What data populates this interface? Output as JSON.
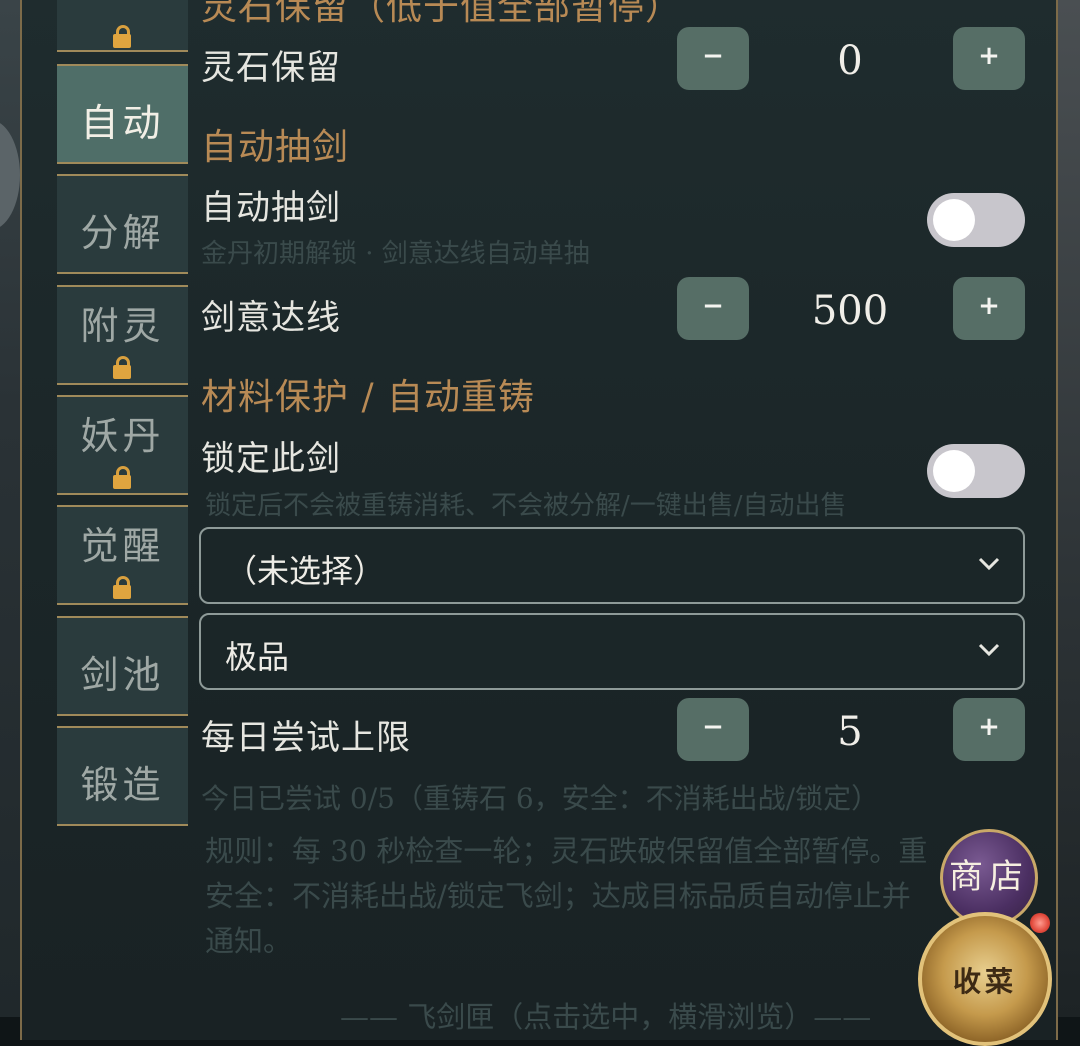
{
  "sidebar": {
    "items": [
      {
        "label": "",
        "locked": true
      },
      {
        "label": "自动",
        "locked": false,
        "active": true
      },
      {
        "label": "分解",
        "locked": false
      },
      {
        "label": "附灵",
        "locked": true
      },
      {
        "label": "妖丹",
        "locked": true
      },
      {
        "label": "觉醒",
        "locked": true
      },
      {
        "label": "剑池",
        "locked": false
      },
      {
        "label": "锻造",
        "locked": false
      }
    ]
  },
  "main": {
    "cropped_section_title": "灵石保留（低于值全部暂停）",
    "spirit_stone": {
      "label": "灵石保留",
      "value": "0",
      "minus": "−",
      "plus": "+"
    },
    "auto_draw_section": "自动抽剑",
    "auto_draw": {
      "label": "自动抽剑",
      "enabled": false,
      "hint": "金丹初期解锁 · 剑意达线自动单抽"
    },
    "sword_intent": {
      "label": "剑意达线",
      "value": "500",
      "minus": "−",
      "plus": "+"
    },
    "protect_section": "材料保护 / 自动重铸",
    "lock_sword": {
      "label": "锁定此剑",
      "enabled": false,
      "hint": "锁定后不会被重铸消耗、不会被分解/一键出售/自动出售"
    },
    "select_sword": {
      "value": "（未选择）"
    },
    "select_quality": {
      "value": "极品"
    },
    "daily_limit": {
      "label": "每日尝试上限",
      "value": "5",
      "minus": "−",
      "plus": "+",
      "status": "今日已尝试 0/5（重铸石 6，安全：不消耗出战/锁定）"
    },
    "rules": {
      "line1": "规则：每 30 秒检查一轮；灵石跌破保留值全部暂停。重",
      "line2": "安全：不消耗出战/锁定飞剑；达成目标品质自动停止并",
      "line3": "通知。"
    },
    "bottom_cropped": "—— 飞剑匣（点击选中，横滑浏览）——"
  },
  "floating": {
    "shop_label": "商店",
    "collect_label": "收菜"
  },
  "colors": {
    "accent_title": "#b88a55",
    "button_bg": "#566e66",
    "tab_active_bg": "#4f6e68",
    "border_gold": "#a08a5a",
    "lock_gold": "#e0a53f"
  }
}
